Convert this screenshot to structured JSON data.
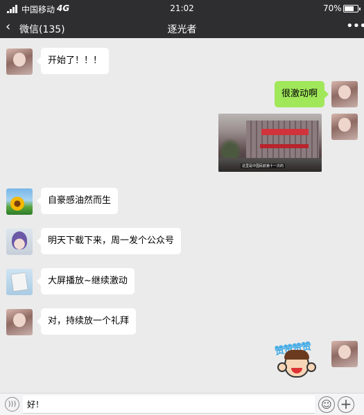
{
  "status_bar": {
    "carrier": "中国移动",
    "network": "4G",
    "time": "21:02",
    "battery_percent": "70%",
    "battery_level": 0.7,
    "signal_bars": 4
  },
  "nav": {
    "back_label": "微信(135)",
    "title": "逐光者",
    "back_icon": "chevron-left-icon",
    "more_icon": "more-dots-icon"
  },
  "messages": [
    {
      "direction": "in",
      "avatar": "girl",
      "text": "开始了！！！"
    },
    {
      "direction": "out",
      "avatar": "girl",
      "text": "很激动啊"
    },
    {
      "direction": "out",
      "avatar": "girl",
      "type": "image",
      "caption": "这里是中国民航第十一次的"
    },
    {
      "direction": "in",
      "avatar": "sunflower",
      "text": "自豪感油然而生"
    },
    {
      "direction": "in",
      "avatar": "purple-hair",
      "text": "明天下载下来，周一发个公众号"
    },
    {
      "direction": "in",
      "avatar": "paper",
      "text": "大屏播放~继续激动"
    },
    {
      "direction": "in",
      "avatar": "girl",
      "text": "对，持续放一个礼拜"
    },
    {
      "direction": "out",
      "avatar": "girl",
      "type": "sticker",
      "sticker_text": "赞赞赞赞"
    }
  ],
  "input_bar": {
    "draft": "好！",
    "voice_icon": "voice-icon",
    "emoji_icon": "emoji-icon",
    "plus_icon": "plus-icon"
  },
  "colors": {
    "header_bg": "#2e2e31",
    "chat_bg": "#ebebeb",
    "outgoing_bubble": "#a0e75a",
    "incoming_bubble": "#ffffff"
  }
}
